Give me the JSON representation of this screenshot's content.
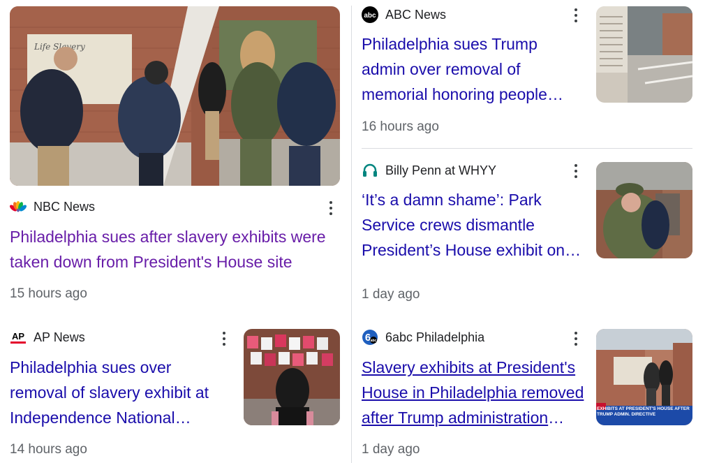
{
  "articles": [
    {
      "source": "NBC News",
      "source_icon": "nbc-peacock-icon",
      "headline": "Philadelphia sues after slavery exhibits were taken down from President's House site",
      "time": "15 hours ago",
      "headline_color": "#681da8"
    },
    {
      "source": "ABC News",
      "source_icon": "abc-logo-icon",
      "headline": "Philadelphia sues Trump admin over removal of memorial honoring people enslaved by George Washington",
      "time": "16 hours ago"
    },
    {
      "source": "Billy Penn at WHYY",
      "source_icon": "headphones-icon",
      "headline": "‘It’s a damn shame’: Park Service crews dismantle President’s House exhibit on slavery",
      "time": "1 day ago"
    },
    {
      "source": "AP News",
      "source_icon": "ap-logo-icon",
      "headline": "Philadelphia sues over removal of slavery exhibit at Independence National Historical Park",
      "time": "14 hours ago"
    },
    {
      "source": "6abc Philadelphia",
      "source_icon": "6abc-logo-icon",
      "headline": "Slavery exhibits at President's House in Philadelphia removed after Trump administration directive",
      "time": "1 day ago",
      "thumb_caption": "EXHIBITS AT PRESIDENT'S HOUSE AFTER TRUMP ADMIN. DIRECTIVE"
    }
  ],
  "colors": {
    "link": "#1a0dab",
    "visited": "#681da8",
    "meta": "#5f6368"
  }
}
